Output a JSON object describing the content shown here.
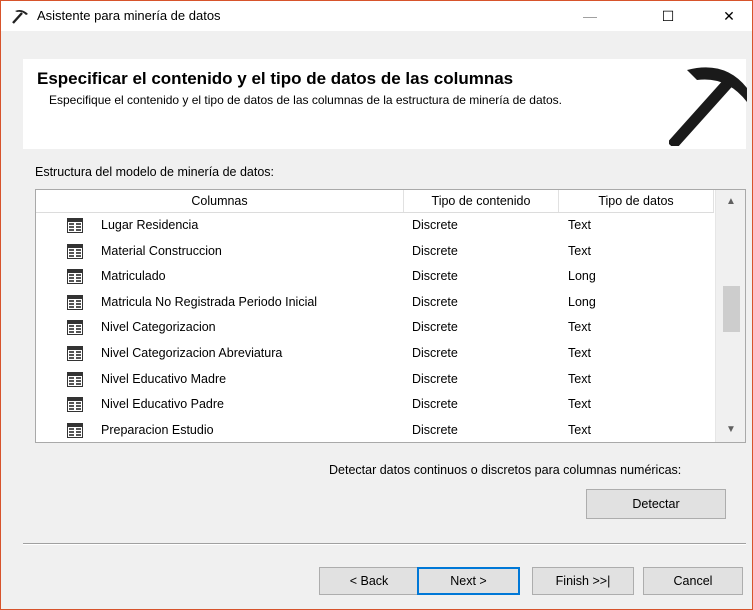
{
  "window": {
    "title": "Asistente para minería de datos",
    "minimize_glyph": "—",
    "maximize_glyph": "☐",
    "close_glyph": "✕"
  },
  "header": {
    "title": "Especificar el contenido y el tipo de datos de las columnas",
    "subtitle": "Especifique el contenido y el tipo de datos de las columnas de la estructura de minería de datos.",
    "icon": "pickaxe-icon"
  },
  "structure_label": "Estructura del modelo de minería de datos:",
  "grid": {
    "columns": [
      "Columnas",
      "Tipo de contenido",
      "Tipo de datos"
    ],
    "rows": [
      {
        "name": "Lugar Residencia",
        "content_type": "Discrete",
        "data_type": "Text"
      },
      {
        "name": "Material Construccion",
        "content_type": "Discrete",
        "data_type": "Text"
      },
      {
        "name": "Matriculado",
        "content_type": "Discrete",
        "data_type": "Long"
      },
      {
        "name": "Matricula No Registrada Periodo Inicial",
        "content_type": "Discrete",
        "data_type": "Long"
      },
      {
        "name": "Nivel Categorizacion",
        "content_type": "Discrete",
        "data_type": "Text"
      },
      {
        "name": "Nivel Categorizacion Abreviatura",
        "content_type": "Discrete",
        "data_type": "Text"
      },
      {
        "name": "Nivel Educativo Madre",
        "content_type": "Discrete",
        "data_type": "Text"
      },
      {
        "name": "Nivel Educativo Padre",
        "content_type": "Discrete",
        "data_type": "Text"
      },
      {
        "name": "Preparacion Estudio",
        "content_type": "Discrete",
        "data_type": "Text"
      }
    ],
    "scroll_up_glyph": "▲",
    "scroll_down_glyph": "▼",
    "row_icon": "table-column-icon"
  },
  "detect": {
    "label": "Detectar datos continuos o discretos para columnas numéricas:",
    "button": "Detectar"
  },
  "footer": {
    "back": "< Back",
    "next": "Next >",
    "finish": "Finish >>|",
    "cancel": "Cancel"
  },
  "colors": {
    "window_border": "#d7532b",
    "default_button_border": "#0078d7",
    "dialog_background": "#f0f0f0"
  }
}
